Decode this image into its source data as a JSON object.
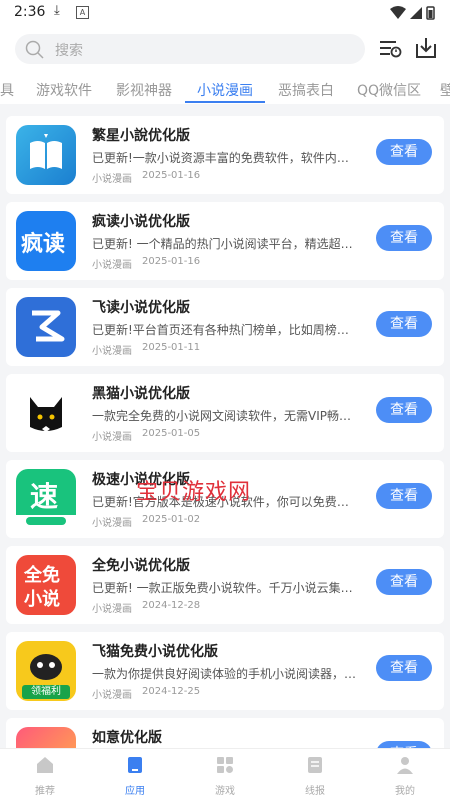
{
  "status_bar": {
    "time": "2:36",
    "download_icon": "download-icon",
    "a_icon": "A"
  },
  "search": {
    "placeholder": "搜索"
  },
  "tabs": [
    {
      "label": "具"
    },
    {
      "label": "游戏软件"
    },
    {
      "label": "影视神器"
    },
    {
      "label": "小说漫画"
    },
    {
      "label": "恶搞表白"
    },
    {
      "label": "QQ微信区"
    },
    {
      "label": "壁"
    }
  ],
  "active_tab": "小说漫画",
  "apps": [
    {
      "name": "繁星小說优化版",
      "desc": "已更新!一款小说资源丰富的免费软件，软件内的...",
      "category": "小说漫画",
      "date": "2025-01-16",
      "button": "查看"
    },
    {
      "name": "疯读小说优化版",
      "desc": "已更新! 一个精品的热门小说阅读平台，精选超多...",
      "category": "小说漫画",
      "date": "2025-01-16",
      "button": "查看"
    },
    {
      "name": "飞读小说优化版",
      "desc": "已更新!平台首页还有各种热门榜单，比如周榜、...",
      "category": "小说漫画",
      "date": "2025-01-11",
      "button": "查看"
    },
    {
      "name": "黑猫小说优化版",
      "desc": "一款完全免费的小说网文阅读软件，无需VIP畅读...",
      "category": "小说漫画",
      "date": "2025-01-05",
      "button": "查看"
    },
    {
      "name": "极速小说优化版",
      "desc": "已更新!官方版本是极速小说软件，你可以免费阅...",
      "category": "小说漫画",
      "date": "2025-01-02",
      "button": "查看"
    },
    {
      "name": "全免小说优化版",
      "desc": "已更新! 一款正版免费小说软件。千万小说云集，...",
      "category": "小说漫画",
      "date": "2024-12-28",
      "button": "查看"
    },
    {
      "name": "飞猫免费小说优化版",
      "desc": "一款为你提供良好阅读体验的手机小说阅读器，通...",
      "category": "小说漫画",
      "date": "2024-12-25",
      "button": "查看"
    },
    {
      "name": "如意优化版",
      "desc": "",
      "category": "",
      "date": "",
      "button": "查看"
    }
  ],
  "icon_texts": {
    "fengdu": "疯读",
    "jisu": "速",
    "quanmian_1": "全免",
    "quanmian_2": "小说",
    "feimao_badge": "领福利"
  },
  "watermark": "宝贝游戏网",
  "bottom_nav": [
    {
      "label": "推荐",
      "icon": "home-icon"
    },
    {
      "label": "应用",
      "icon": "apps-icon"
    },
    {
      "label": "游戏",
      "icon": "games-icon"
    },
    {
      "label": "线报",
      "icon": "news-icon"
    },
    {
      "label": "我的",
      "icon": "profile-icon"
    }
  ],
  "colors": {
    "accent": "#3b7ff0",
    "button": "#4d8ef6",
    "watermark": "#e0303a"
  }
}
